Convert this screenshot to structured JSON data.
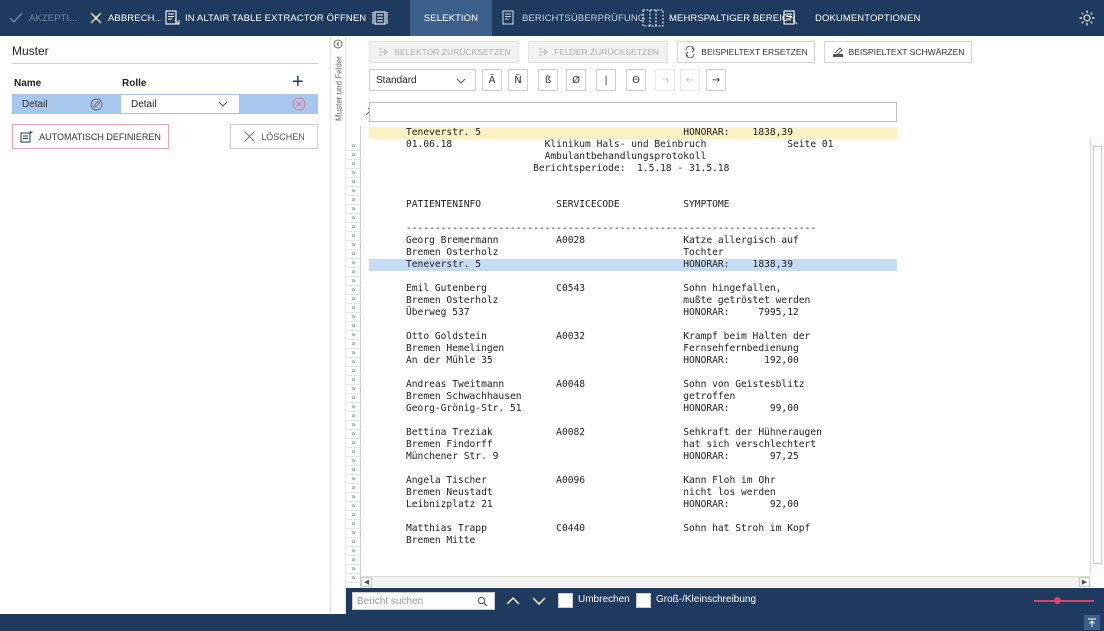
{
  "toolbar": {
    "accept_label": "Akzepti...",
    "cancel_label": "Abbrech...",
    "open_tex_label": "In Altair Table Extractor öffnen",
    "selection_label": "Selektion",
    "report_check_label": "Berichtsüberprüfung",
    "multicolumn_label": "Mehrspaltiger Bereich",
    "docoptions_label": "Dokumentoptionen",
    "icons": [
      "check-icon",
      "close-icon",
      "table-extract-icon",
      "selection-icon",
      "report-check-icon",
      "multicolumn-icon",
      "docoptions-icon",
      "gear-icon"
    ],
    "colors": {
      "bar": "#1f3a5f",
      "active": "#3d5f8c",
      "disabled_text": "#6f86a5"
    }
  },
  "left": {
    "title": "Muster",
    "col_name": "Name",
    "col_role": "Rolle",
    "row": {
      "name": "Detail",
      "role": "Detail"
    },
    "auto_define_label": "Automatisch definieren",
    "delete_label": "Löschen",
    "vertical_label": "Muster und Felder"
  },
  "right": {
    "reset_selector_label": "Selektor zurücksetzen",
    "reset_fields_label": "Felder zurücksetzen",
    "replace_sample_label": "Beispieltext ersetzen",
    "redact_sample_label": "Beispieltext schwärzen",
    "format_value": "Standard",
    "chars": [
      "Ã",
      "Ñ",
      "ß",
      "Ø",
      "|",
      "Θ",
      "¬",
      "←",
      "→"
    ],
    "chars_disabled": [
      false,
      false,
      false,
      false,
      false,
      false,
      true,
      true,
      false
    ]
  },
  "report": {
    "lines": [
      "Teneverstr. 5                                   HONORAR:    1838,39",
      "01.06.18                Klinikum Hals- und Beinbruch              Seite 01",
      "                        Ambulantbehandlungsprotokoll",
      "                      Berichtsperiode:  1.5.18 - 31.5.18",
      "",
      "",
      "PATIENTENINFO             SERVICECODE           SYMPTOME",
      "",
      "-----------------------------------------------------------------------",
      "Georg Bremermann          A0028                 Katze allergisch auf",
      "Bremen Osterholz                                Tochter",
      "Teneverstr. 5                                   HONORAR:    1838,39",
      "",
      "Emil Gutenberg            C0543                 Sohn hingefallen,",
      "Bremen Osterholz                                mußte getröstet werden",
      "Überweg 537                                     HONORAR:     7995,12",
      "",
      "Otto Goldstein            A0032                 Krampf beim Halten der",
      "Bremen Hemelingen                               Fernsehfernbedienung",
      "An der Mühle 35                                 HONORAR:      192,00",
      "",
      "Andreas Tweitmann         A0048                 Sohn von Geistesblitz",
      "Bremen Schwachhausen                            getroffen",
      "Georg-Grönig-Str. 51                            HONORAR:       99,00",
      "",
      "Bettina Treziak           A0082                 Sehkraft der Hühneraugen",
      "Bremen Findorff                                 hat sich verschlechtert",
      "Münchener Str. 9                                HONORAR:       97,25",
      "",
      "Angela Tischer            A0096                 Kann Floh im Ohr",
      "Bremen Neustadt                                 nicht los werden",
      "Leibnizplatz 21                                 HONORAR:       92,00",
      "",
      "Matthias Trapp            C0440                 Sohn hat Stroh im Kopf",
      "Bremen Mitte"
    ],
    "gutter_marker": "»",
    "highlight_yellow_index": 0,
    "highlight_blue_index": 11
  },
  "search": {
    "placeholder": "Bericht suchen",
    "wrap_label": "Umbrechen",
    "case_label": "Groß-/Kleinschreibung",
    "zoom_level": 0.33,
    "colors": {
      "slider": "#e0436a"
    }
  }
}
